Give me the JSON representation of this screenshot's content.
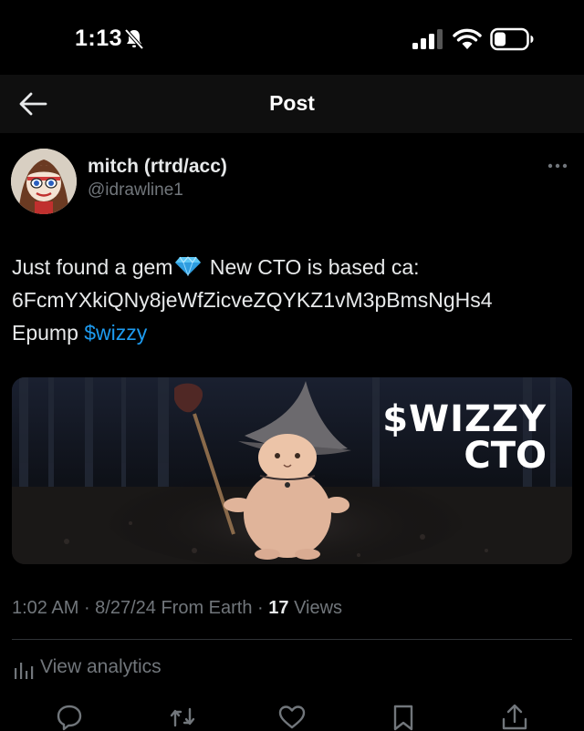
{
  "status_bar": {
    "time": "1:13"
  },
  "header": {
    "title": "Post"
  },
  "post": {
    "author": {
      "display_name": "mitch (rtrd/acc)",
      "handle": "@idrawline1"
    },
    "text": {
      "line1_before_gem": "Just found a gem",
      "line1_after_gem": "New CTO is based ca:",
      "line2": "6FcmYXkiQNy8jeWfZicveZQYKZ1vM3pBmsNgHs4",
      "line3_prefix": "Epump ",
      "cashtag": "$wizzy"
    },
    "media": {
      "caption_line1": "$WIZZY",
      "caption_line2": "CTO"
    },
    "meta": {
      "time": "1:02 AM",
      "separator1": " · ",
      "date": "8/27/24",
      "source": " From Earth",
      "separator2": " · ",
      "views_count": "17",
      "views_label": " Views"
    },
    "analytics_label": "View analytics"
  },
  "actions": [
    "reply-icon",
    "repost-icon",
    "like-icon",
    "bookmark-icon",
    "share-icon"
  ],
  "colors": {
    "background": "#000000",
    "accent": "#1d9bf0",
    "secondary_text": "#71767b"
  }
}
